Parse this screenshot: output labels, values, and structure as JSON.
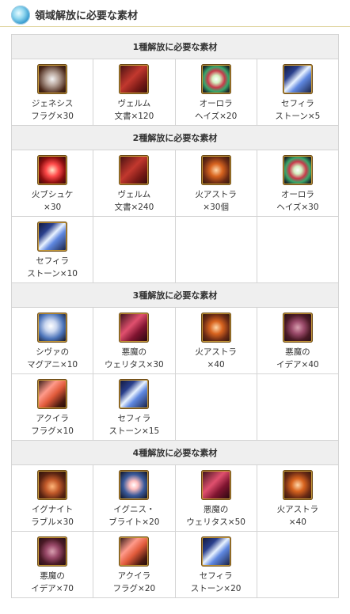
{
  "header": {
    "title": "領域解放に必要な素材",
    "icon": "orb-icon"
  },
  "sections": [
    {
      "title": "1種解放に必要な素材",
      "items": [
        {
          "label": "ジェネシス\nフラグ×30",
          "icon": "genesis"
        },
        {
          "label": "ヴェルム\n文書×120",
          "icon": "velum"
        },
        {
          "label": "オーロラ\nヘイズ×20",
          "icon": "aurora"
        },
        {
          "label": "セフィラ\nストーン×5",
          "icon": "sefira"
        }
      ]
    },
    {
      "title": "2種解放に必要な素材",
      "items": [
        {
          "label": "火ブシュケ\n×30",
          "icon": "fire"
        },
        {
          "label": "ヴェルム\n文書×240",
          "icon": "velum"
        },
        {
          "label": "火アストラ\n×30個",
          "icon": "astra"
        },
        {
          "label": "オーロラ\nヘイズ×30",
          "icon": "aurora"
        },
        {
          "label": "セフィラ\nストーン×10",
          "icon": "sefira"
        }
      ]
    },
    {
      "title": "3種解放に必要な素材",
      "items": [
        {
          "label": "シヴァの\nマグアニ×10",
          "icon": "shiva"
        },
        {
          "label": "悪魔の\nウェリタス×30",
          "icon": "demon"
        },
        {
          "label": "火アストラ\n×40",
          "icon": "astra"
        },
        {
          "label": "悪魔の\nイデア×40",
          "icon": "idea"
        },
        {
          "label": "アクイラ\nフラグ×10",
          "icon": "akuila"
        },
        {
          "label": "セフィラ\nストーン×15",
          "icon": "sefira"
        }
      ]
    },
    {
      "title": "4種解放に必要な素材",
      "items": [
        {
          "label": "イグナイト\nラブル×30",
          "icon": "ignite"
        },
        {
          "label": "イグニス・\nブライト×20",
          "icon": "bright"
        },
        {
          "label": "悪魔の\nウェリタス×50",
          "icon": "demon"
        },
        {
          "label": "火アストラ\n×40",
          "icon": "astra"
        },
        {
          "label": "悪魔の\nイデア×70",
          "icon": "idea"
        },
        {
          "label": "アクイラ\nフラグ×20",
          "icon": "akuila"
        },
        {
          "label": "セフィラ\nストーン×20",
          "icon": "sefira"
        }
      ]
    }
  ]
}
